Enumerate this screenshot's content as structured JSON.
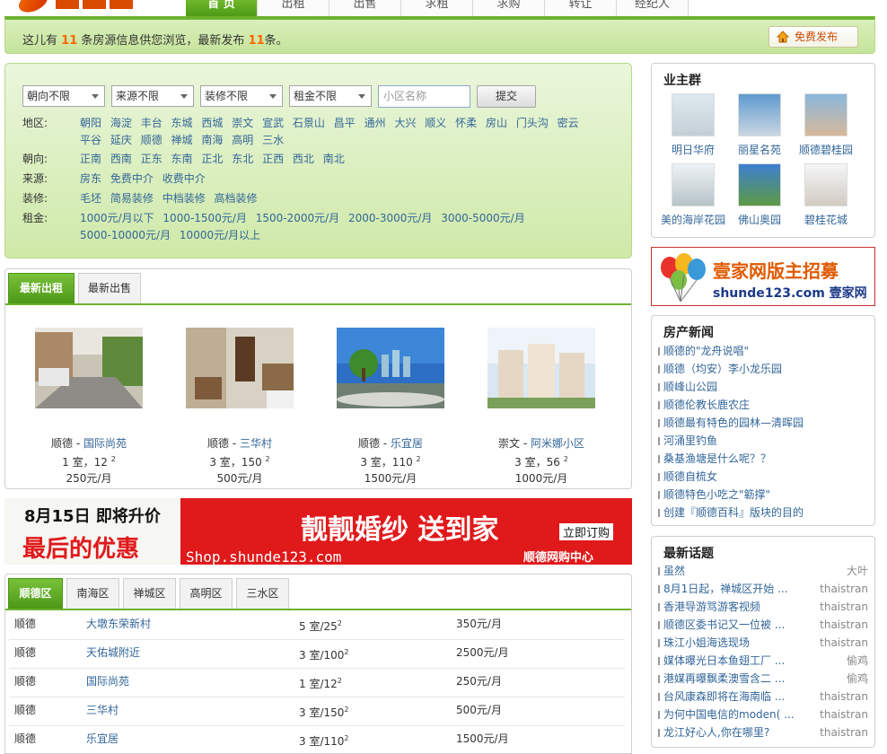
{
  "nav": {
    "items": [
      {
        "label": "首 页",
        "active": true
      },
      {
        "label": "出租",
        "active": false
      },
      {
        "label": "出售",
        "active": false
      },
      {
        "label": "求租",
        "active": false
      },
      {
        "label": "求购",
        "active": false
      },
      {
        "label": "转让",
        "active": false
      },
      {
        "label": "经纪人",
        "active": false
      }
    ]
  },
  "notice": {
    "prefix": "这儿有",
    "count1": "11",
    "middle": "条房源信息供您浏览，最新发布",
    "count2": "11",
    "suffix": "条。",
    "publish_label": "免费发布"
  },
  "filter": {
    "selects": [
      "朝向不限",
      "来源不限",
      "装修不限",
      "租金不限"
    ],
    "community_placeholder": "小区名称",
    "submit_label": "提交",
    "rows": [
      {
        "label": "地区:",
        "options": [
          "朝阳",
          "海淀",
          "丰台",
          "东城",
          "西城",
          "崇文",
          "宣武",
          "石景山",
          "昌平",
          "通州",
          "大兴",
          "顺义",
          "怀柔",
          "房山",
          "门头沟",
          "密云",
          "平谷",
          "延庆",
          "顺德",
          "禅城",
          "南海",
          "高明",
          "三水"
        ]
      },
      {
        "label": "朝向:",
        "options": [
          "正南",
          "西南",
          "正东",
          "东南",
          "正北",
          "东北",
          "正西",
          "西北",
          "南北"
        ]
      },
      {
        "label": "来源:",
        "options": [
          "房东",
          "免费中介",
          "收费中介"
        ]
      },
      {
        "label": "装修:",
        "options": [
          "毛坯",
          "简易装修",
          "中档装修",
          "高档装修"
        ]
      },
      {
        "label": "租金:",
        "options": [
          "1000元/月以下",
          "1000-1500元/月",
          "1500-2000元/月",
          "2000-3000元/月",
          "3000-5000元/月",
          "5000-10000元/月",
          "10000元/月以上"
        ]
      }
    ]
  },
  "listing": {
    "tabs": [
      {
        "label": "最新出租",
        "active": true
      },
      {
        "label": "最新出售",
        "active": false
      }
    ],
    "cards": [
      {
        "district": "顺德",
        "name": "国际尚苑",
        "rooms": "1 室，12",
        "area_sup": "2",
        "price": "250元/月"
      },
      {
        "district": "顺德",
        "name": "三华村",
        "rooms": "3 室，150",
        "area_sup": "2",
        "price": "500元/月"
      },
      {
        "district": "顺德",
        "name": "乐宜居",
        "rooms": "3 室，110",
        "area_sup": "2",
        "price": "1500元/月"
      },
      {
        "district": "崇文",
        "name": "阿米娜小区",
        "rooms": "3 室，56",
        "area_sup": "2",
        "price": "1000元/月"
      }
    ]
  },
  "banner": {
    "date_text": "8月15日 即将升价",
    "big_text": "最后的优惠",
    "slogan": "靓靓婚纱 送到家",
    "url": "Shop.shunde123.com",
    "button": "立即订购",
    "brand": "顺德网购中心"
  },
  "district": {
    "tabs": [
      {
        "label": "顺德区",
        "active": true
      },
      {
        "label": "南海区",
        "active": false
      },
      {
        "label": "禅城区",
        "active": false
      },
      {
        "label": "高明区",
        "active": false
      },
      {
        "label": "三水区",
        "active": false
      }
    ],
    "rows": [
      {
        "district": "顺德",
        "name": "大墩东荣新村",
        "rooms": "5 室/25",
        "sup": "2",
        "price": "350元/月"
      },
      {
        "district": "顺德",
        "name": "天佑城附近",
        "rooms": "3 室/100",
        "sup": "2",
        "price": "2500元/月"
      },
      {
        "district": "顺德",
        "name": "国际尚苑",
        "rooms": "1 室/12",
        "sup": "2",
        "price": "250元/月"
      },
      {
        "district": "顺德",
        "name": "三华村",
        "rooms": "3 室/150",
        "sup": "2",
        "price": "500元/月"
      },
      {
        "district": "顺德",
        "name": "乐宜居",
        "rooms": "3 室/110",
        "sup": "2",
        "price": "1500元/月"
      }
    ]
  },
  "owners": {
    "title": "业主群",
    "items": [
      "明日华府",
      "丽星名苑",
      "顺德碧桂园",
      "美的海岸花园",
      "佛山奥园",
      "碧桂花城"
    ]
  },
  "ad": {
    "line1": "壹家网版主招募",
    "line2": "shunde123.com 壹家网"
  },
  "news": {
    "title": "房产新闻",
    "items": [
      "顺德的\"龙舟说唱\"",
      "顺德（均安）李小龙乐园",
      "顺峰山公园",
      "顺德伦教长鹿农庄",
      "顺德最有特色的园林—清晖园",
      "河涌里钓鱼",
      "桑基渔塘是什么呢？？",
      "顺德自梳女",
      "顺德特色小吃之\"簕撑\"",
      "创建『顺德百科』版块的目的"
    ]
  },
  "topics": {
    "title": "最新话题",
    "items": [
      {
        "title": "虽然",
        "user": "大叶"
      },
      {
        "title": "8月1日起，禅城区开始 ...",
        "user": "thaistran"
      },
      {
        "title": "香港导游骂游客视频",
        "user": "thaistran"
      },
      {
        "title": "顺德区委书记又一位被 ...",
        "user": "thaistran"
      },
      {
        "title": "珠江小姐海选现场",
        "user": "thaistran"
      },
      {
        "title": "媒体曝光日本鱼翅工厂 ...",
        "user": "偷鸡"
      },
      {
        "title": "港媒再曝飘柔澳雪含二 ...",
        "user": "偷鸡"
      },
      {
        "title": "台风康森即将在海南临 ...",
        "user": "thaistran"
      },
      {
        "title": "为何中国电信的moden( ...",
        "user": "thaistran"
      },
      {
        "title": "龙江好心人,你在哪里?",
        "user": "thaistran"
      }
    ]
  },
  "colors": {
    "accent": "#6db12e",
    "link": "#336699",
    "highlight": "#ff6600",
    "banner_red": "#e0191b"
  }
}
